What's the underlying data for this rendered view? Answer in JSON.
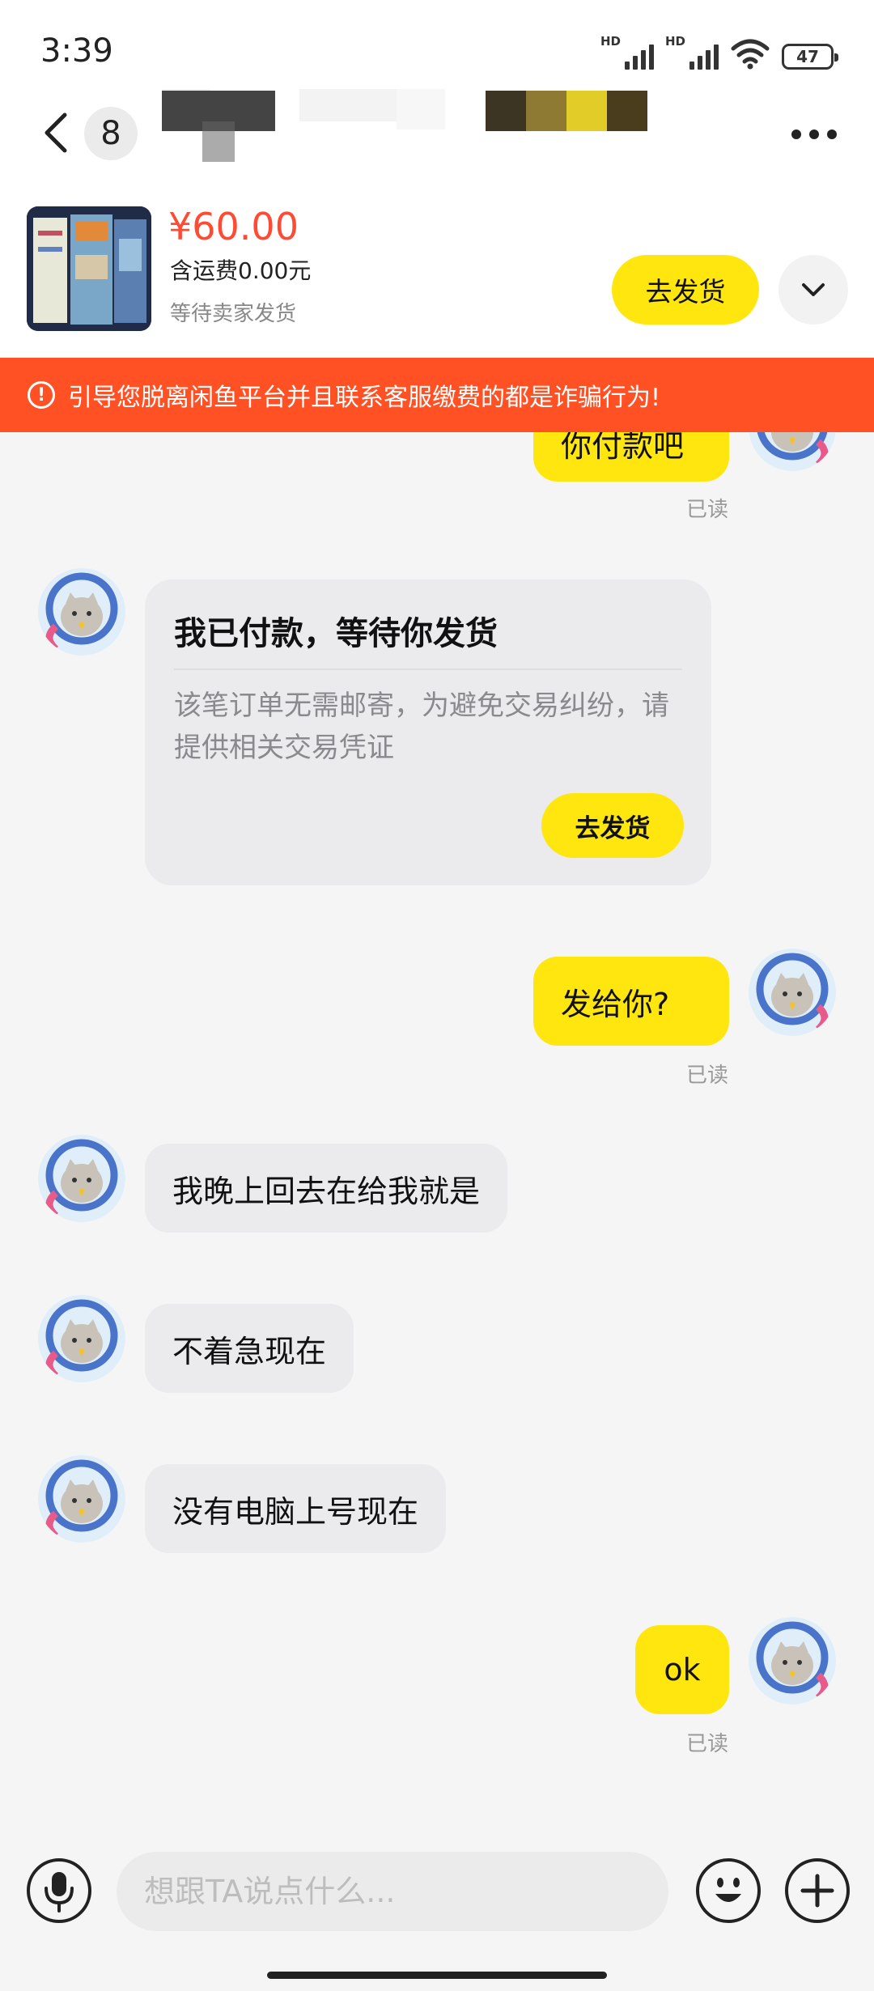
{
  "status_bar": {
    "time": "3:39",
    "signal_1_label": "HD",
    "signal_2_label": "HD",
    "battery_level": "47"
  },
  "nav": {
    "unread_count": "8"
  },
  "order": {
    "price": "¥60.00",
    "shipping": "含运费0.00元",
    "status": "等待卖家发货",
    "ship_button": "去发货"
  },
  "warning": {
    "text": "引导您脱离闲鱼平台并且联系客服缴费的都是诈骗行为!"
  },
  "chat": {
    "messages": [
      {
        "from": "me",
        "text": "你付款吧",
        "read": "已读"
      },
      {
        "from": "them",
        "type": "card",
        "title": "我已付款，等待你发货",
        "body": "该笔订单无需邮寄，为避免交易纠纷，请提供相关交易凭证",
        "button": "去发货"
      },
      {
        "from": "me",
        "text": "发给你?",
        "read": "已读"
      },
      {
        "from": "them",
        "text": "我晚上回去在给我就是"
      },
      {
        "from": "them",
        "text": "不着急现在"
      },
      {
        "from": "them",
        "text": "没有电脑上号现在"
      },
      {
        "from": "me",
        "text": "ok",
        "read": "已读"
      }
    ]
  },
  "input": {
    "placeholder": "想跟TA说点什么..."
  },
  "colors": {
    "accent_yellow": "#ffe60f",
    "warning_orange": "#ff5124",
    "price_red": "#ff4b33"
  },
  "icons": [
    "back-icon",
    "more-icon",
    "chevron-down-icon",
    "warning-icon",
    "microphone-icon",
    "emoji-icon",
    "plus-icon"
  ]
}
